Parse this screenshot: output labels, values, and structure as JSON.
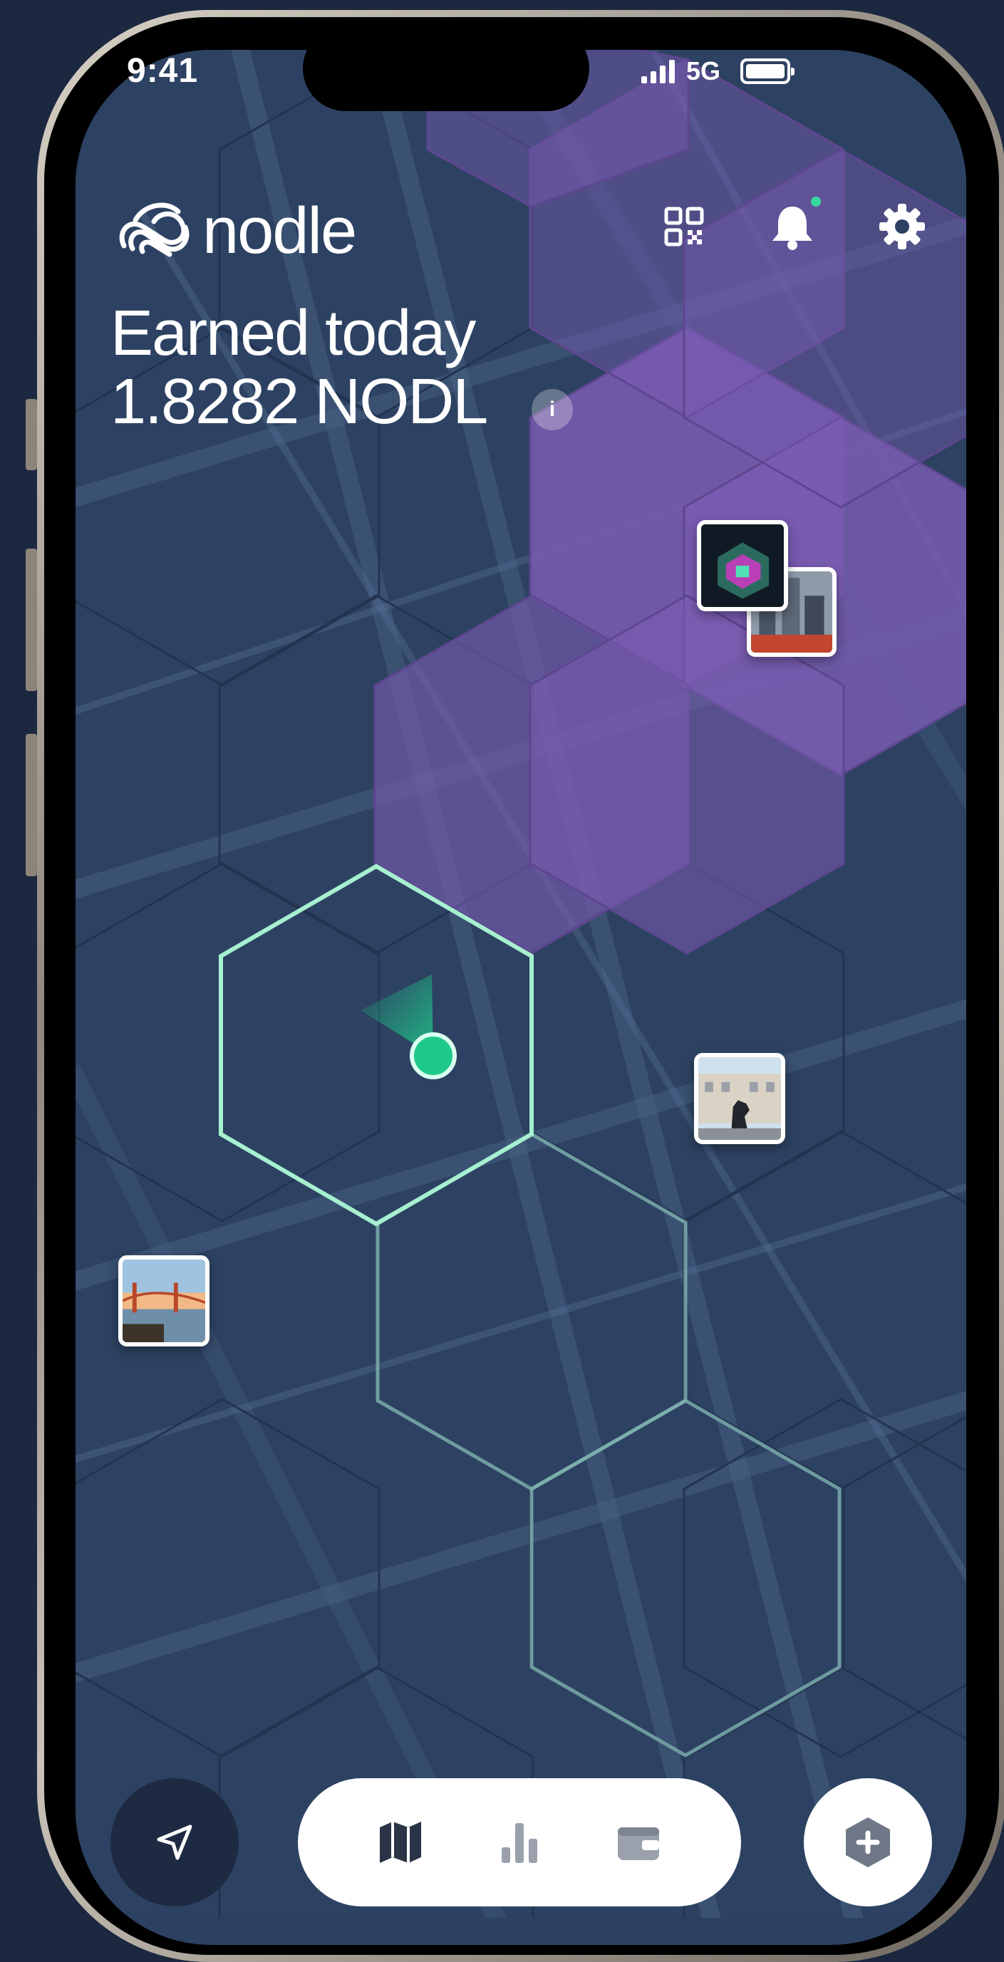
{
  "status_bar": {
    "time": "9:41",
    "network": "5G"
  },
  "header": {
    "brand": "nodle",
    "icons": [
      "qr-code-icon",
      "bell-icon",
      "gear-icon"
    ],
    "notification_dot_color": "#3ad6a0"
  },
  "earnings": {
    "label": "Earned today",
    "amount": "1.8282 NODL",
    "info_icon": "i"
  },
  "map": {
    "colors": {
      "hex_default": "#2f4566",
      "hex_claimed": "#7b5cb3",
      "current_cell_outline": "#a6f0d0",
      "trail_outline": "#7fb3b0",
      "user_dot": "#1fc98a"
    },
    "photo_markers": [
      "city-night-photo",
      "skyscrapers-photo",
      "statue-building-photo",
      "golden-gate-photo"
    ]
  },
  "bottom_bar": {
    "locate_icon": "navigation-arrow-icon",
    "tabs": [
      "map-icon",
      "stats-icon",
      "wallet-icon"
    ],
    "add_icon": "plus-hexagon-icon"
  }
}
